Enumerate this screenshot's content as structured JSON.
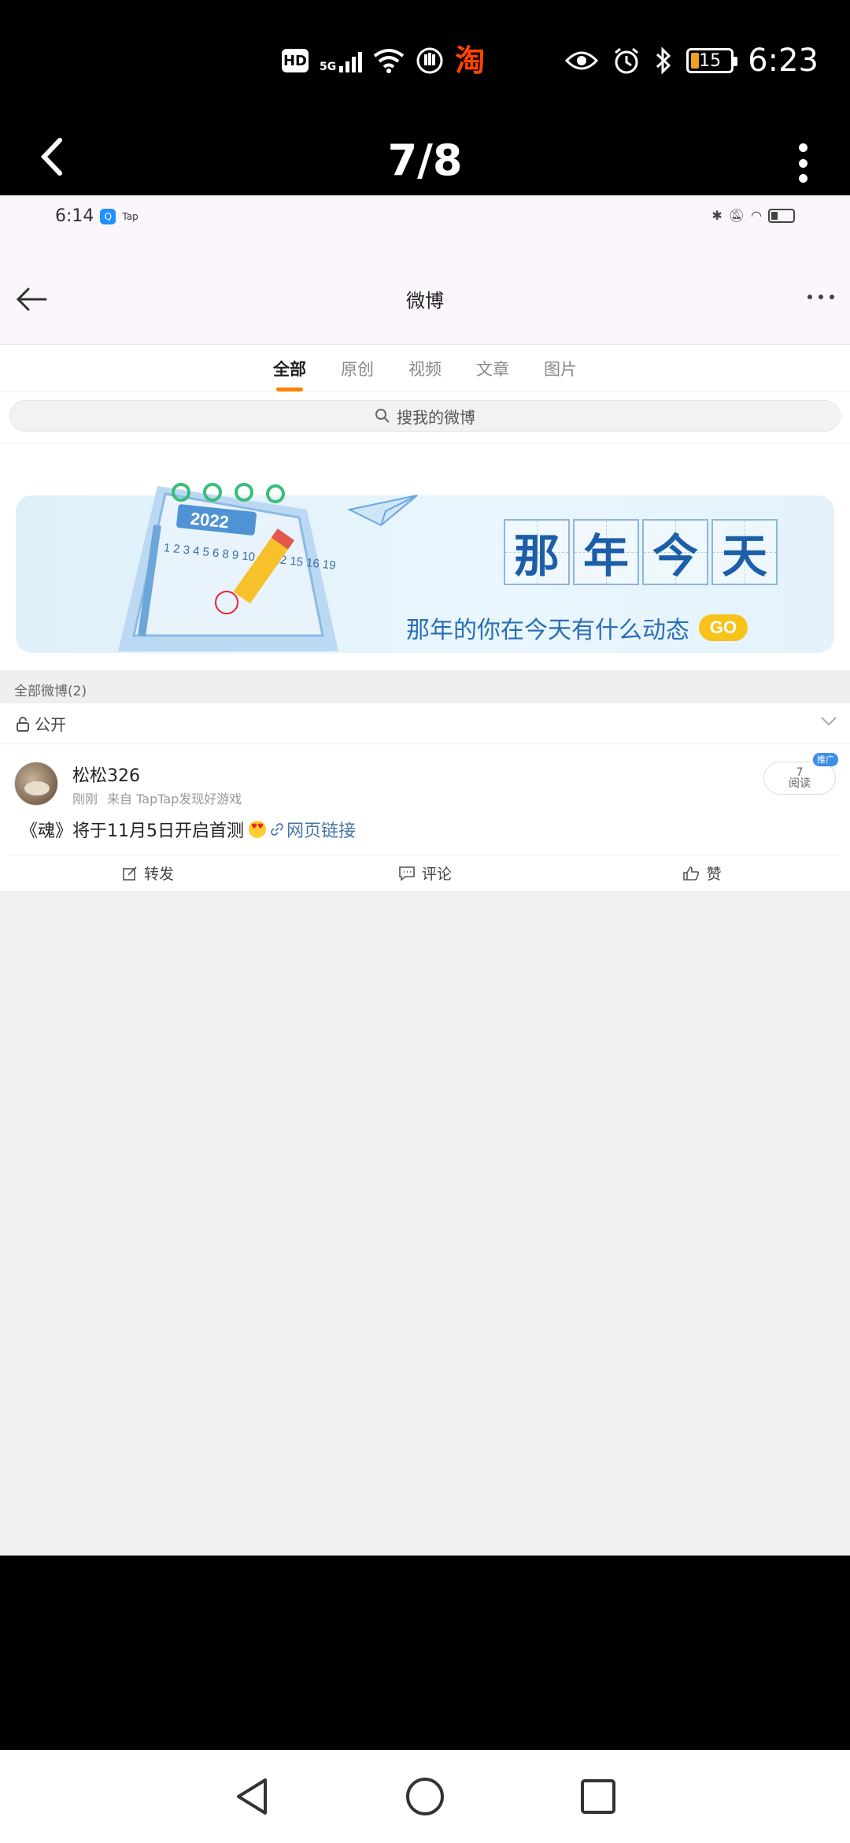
{
  "phone_status": {
    "hd": "HD",
    "network": "5G",
    "taobao_glyph": "淘",
    "battery": "15",
    "time": "6:23"
  },
  "viewer": {
    "counter": "7/8"
  },
  "inner_status": {
    "time": "6:14",
    "app_tag": "Tap"
  },
  "weibo_nav": {
    "title": "微博"
  },
  "tabs": [
    {
      "label": "全部",
      "active": true
    },
    {
      "label": "原创"
    },
    {
      "label": "视频"
    },
    {
      "label": "文章"
    },
    {
      "label": "图片"
    }
  ],
  "search": {
    "placeholder": "搜我的微博"
  },
  "banner": {
    "calendar_year": "2022",
    "calendar_numbers": "1 2 3 4 5 6 8 9 10 11 12 15 16 19 20",
    "title_chars": [
      "那",
      "年",
      "今",
      "天"
    ],
    "subtitle": "那年的你在今天有什么动态",
    "go": "GO"
  },
  "list": {
    "count_label": "全部微博(2)",
    "privacy_label": "公开"
  },
  "post": {
    "author": "松松326",
    "time": "刚刚",
    "source": "来自 TapTap发现好游戏",
    "text": "《魂》将于11月5日开启首测",
    "link": "网页链接",
    "read_count": "7",
    "read_label": "阅读",
    "promo_tag": "推广",
    "actions": {
      "repost": "转发",
      "comment": "评论",
      "like": "赞"
    }
  },
  "colors": {
    "accent": "#ff8200",
    "link": "#4a74a8",
    "banner_text": "#1c5ea8"
  }
}
